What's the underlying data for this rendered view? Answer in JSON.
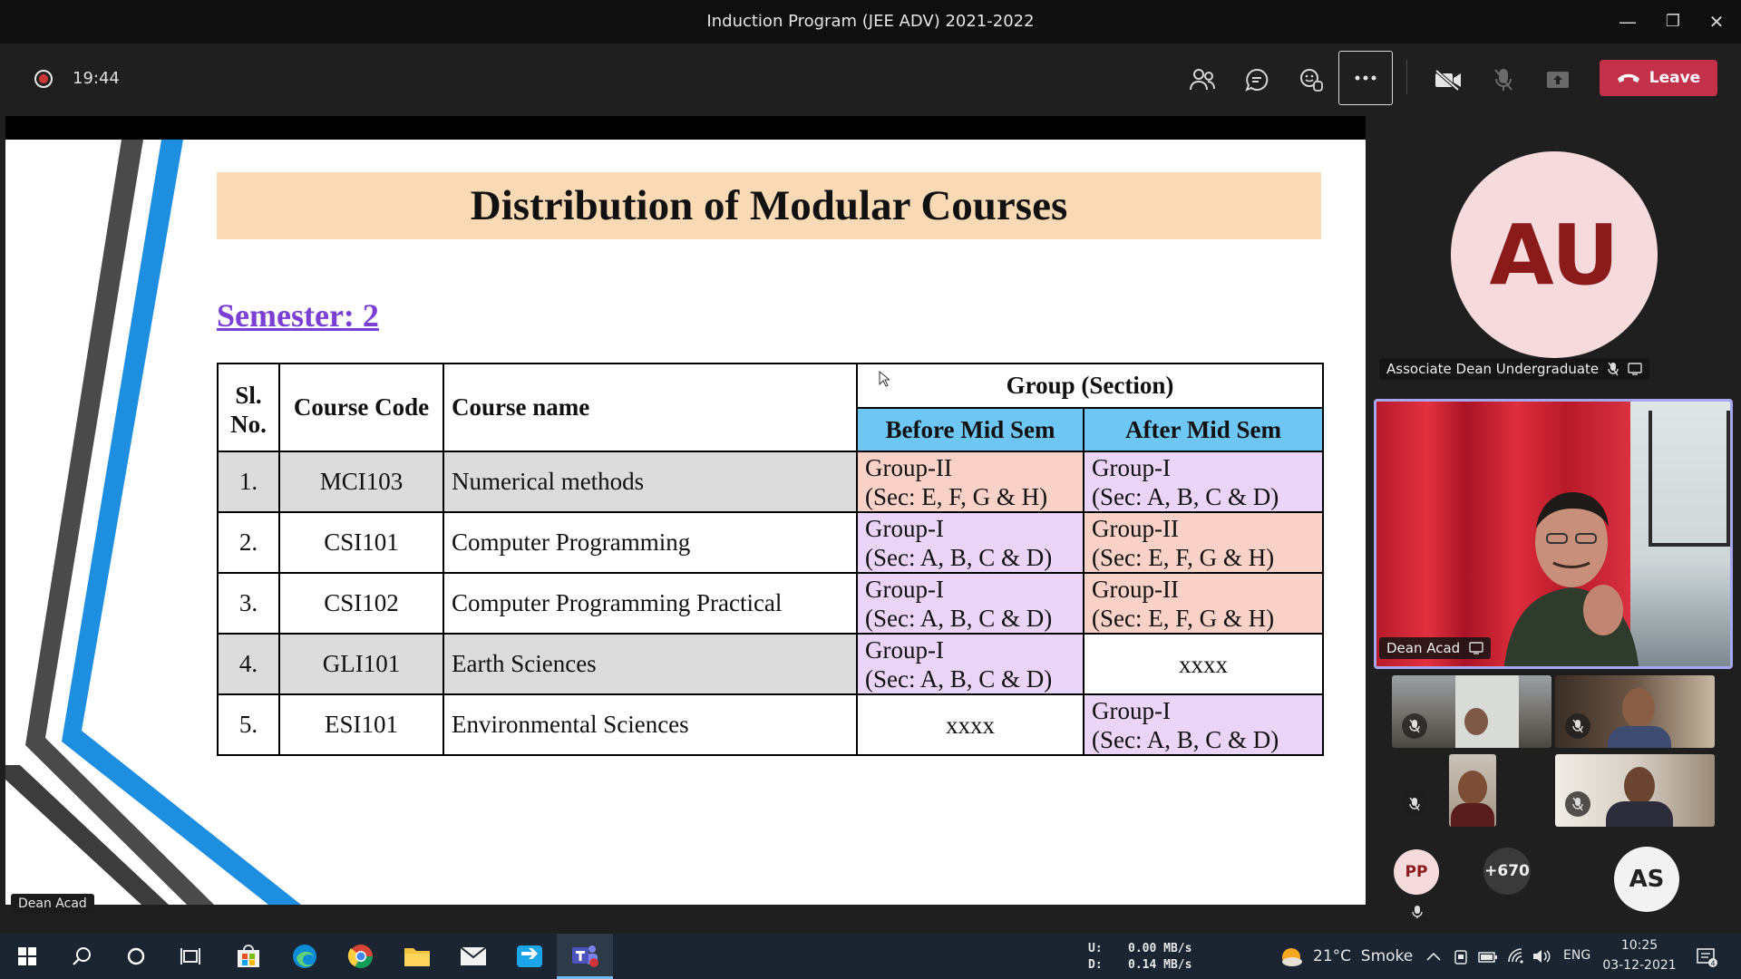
{
  "window": {
    "title": "Induction Program (JEE ADV) 2021-2022",
    "minimize": "—",
    "restore": "❐",
    "close": "✕"
  },
  "meeting_toolbar": {
    "timer": "19:44",
    "leave_label": "Leave",
    "leave_color": "#c4314b"
  },
  "slide": {
    "title": "Distribution of Modular Courses",
    "semester": "Semester: 2",
    "headers": {
      "sl_no": "Sl. No.",
      "course_code": "Course Code",
      "course_name": "Course name",
      "group_section": "Group (Section)",
      "before_mid_sem": "Before Mid Sem",
      "after_mid_sem": "After Mid Sem"
    },
    "rows": [
      {
        "sl": "1.",
        "code": "MCI103",
        "name": "Numerical methods",
        "before_1": "Group-II",
        "before_2": "(Sec: E, F, G & H)",
        "after_1": "Group-I",
        "after_2": "(Sec: A, B, C & D)"
      },
      {
        "sl": "2.",
        "code": "CSI101",
        "name": "Computer Programming",
        "before_1": "Group-I",
        "before_2": "(Sec: A, B, C & D)",
        "after_1": "Group-II",
        "after_2": "(Sec: E, F, G & H)"
      },
      {
        "sl": "3.",
        "code": "CSI102",
        "name": "Computer Programming Practical",
        "before_1": "Group-I",
        "before_2": "(Sec: A, B, C & D)",
        "after_1": "Group-II",
        "after_2": "(Sec: E, F, G & H)"
      },
      {
        "sl": "4.",
        "code": "GLI101",
        "name": "Earth Sciences",
        "before_1": "Group-I",
        "before_2": "(Sec: A, B, C & D)",
        "after_single": "xxxx"
      },
      {
        "sl": "5.",
        "code": "ESI101",
        "name": "Environmental Sciences",
        "before_single": "xxxx",
        "after_1": "Group-I",
        "after_2": "(Sec: A, B, C & D)"
      }
    ],
    "presenter_label": "Dean Acad"
  },
  "participants": {
    "speaker_initials": "AU",
    "speaker_name": "Associate Dean Undergraduate",
    "video_name": "Dean Acad",
    "pp_initials": "PP",
    "overflow_count": "+670",
    "as_initials": "AS"
  },
  "taskbar": {
    "net_up_label": "U:",
    "net_up": "0.00 MB/s",
    "net_down_label": "D:",
    "net_down": "0.14 MB/s",
    "weather": "21°C  Smoke",
    "language": "ENG",
    "time": "10:25",
    "date": "03-12-2021"
  }
}
